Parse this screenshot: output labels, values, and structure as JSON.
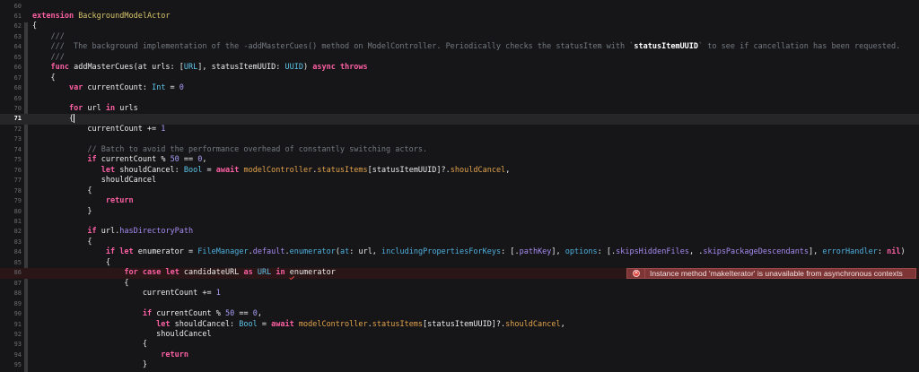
{
  "editor": {
    "current_line": 71,
    "error_line": 86,
    "error_message": "Instance method 'makeIterator' is unavailable from asynchronous contexts",
    "error_icon": "error-x-circle-icon",
    "lines": [
      {
        "n": "60",
        "tokens": []
      },
      {
        "n": "61",
        "tokens": [
          [
            "kw",
            "extension"
          ],
          [
            "pl",
            " "
          ],
          [
            "cls",
            "BackgroundModelActor"
          ]
        ]
      },
      {
        "n": "62",
        "tokens": [
          [
            "pl",
            "{"
          ]
        ]
      },
      {
        "n": "63",
        "tokens": [
          [
            "cm",
            "    ///"
          ]
        ]
      },
      {
        "n": "64",
        "tokens": [
          [
            "cm",
            "    ///  The background implementation of the -addMasterCues() method on ModelController. Periodically checks the statusItem with `"
          ],
          [
            "doc",
            "statusItemUUID"
          ],
          [
            "cm",
            "` to see if cancellation has been requested."
          ]
        ]
      },
      {
        "n": "65",
        "tokens": [
          [
            "cm",
            "    ///"
          ]
        ]
      },
      {
        "n": "66",
        "tokens": [
          [
            "pl",
            "    "
          ],
          [
            "kw",
            "func"
          ],
          [
            "pl",
            " addMasterCues(at urls: ["
          ],
          [
            "ty",
            "URL"
          ],
          [
            "pl",
            "], statusItemUUID: "
          ],
          [
            "ty",
            "UUID"
          ],
          [
            "pl",
            ") "
          ],
          [
            "kw",
            "async"
          ],
          [
            "pl",
            " "
          ],
          [
            "kw",
            "throws"
          ]
        ]
      },
      {
        "n": "67",
        "tokens": [
          [
            "pl",
            "    {"
          ]
        ]
      },
      {
        "n": "68",
        "tokens": [
          [
            "pl",
            "        "
          ],
          [
            "kw",
            "var"
          ],
          [
            "pl",
            " currentCount: "
          ],
          [
            "ty",
            "Int"
          ],
          [
            "pl",
            " = "
          ],
          [
            "num",
            "0"
          ]
        ]
      },
      {
        "n": "69",
        "tokens": []
      },
      {
        "n": "70",
        "tokens": [
          [
            "pl",
            "        "
          ],
          [
            "kw",
            "for"
          ],
          [
            "pl",
            " url "
          ],
          [
            "kw",
            "in"
          ],
          [
            "pl",
            " urls"
          ]
        ]
      },
      {
        "n": "71",
        "tokens": [
          [
            "pl",
            "        {"
          ]
        ]
      },
      {
        "n": "72",
        "tokens": [
          [
            "pl",
            "            currentCount += "
          ],
          [
            "num",
            "1"
          ]
        ]
      },
      {
        "n": "73",
        "tokens": []
      },
      {
        "n": "74",
        "tokens": [
          [
            "cm",
            "            // Batch to avoid the performance overhead of constantly switching actors."
          ]
        ]
      },
      {
        "n": "75",
        "tokens": [
          [
            "pl",
            "            "
          ],
          [
            "kw",
            "if"
          ],
          [
            "pl",
            " currentCount % "
          ],
          [
            "num",
            "50"
          ],
          [
            "pl",
            " == "
          ],
          [
            "num",
            "0"
          ],
          [
            "pl",
            ","
          ]
        ]
      },
      {
        "n": "76",
        "tokens": [
          [
            "pl",
            "               "
          ],
          [
            "kw",
            "let"
          ],
          [
            "pl",
            " shouldCancel: "
          ],
          [
            "ty",
            "Bool"
          ],
          [
            "pl",
            " = "
          ],
          [
            "kw",
            "await"
          ],
          [
            "pl",
            " "
          ],
          [
            "proj",
            "modelController"
          ],
          [
            "pl",
            "."
          ],
          [
            "proj",
            "statusItems"
          ],
          [
            "pl",
            "[statusItemUUID]?."
          ],
          [
            "proj",
            "shouldCancel"
          ],
          [
            "pl",
            ","
          ]
        ]
      },
      {
        "n": "77",
        "tokens": [
          [
            "pl",
            "               shouldCancel"
          ]
        ]
      },
      {
        "n": "78",
        "tokens": [
          [
            "pl",
            "            {"
          ]
        ]
      },
      {
        "n": "79",
        "tokens": [
          [
            "pl",
            "                "
          ],
          [
            "kw",
            "return"
          ]
        ]
      },
      {
        "n": "80",
        "tokens": [
          [
            "pl",
            "            }"
          ]
        ]
      },
      {
        "n": "81",
        "tokens": []
      },
      {
        "n": "82",
        "tokens": [
          [
            "pl",
            "            "
          ],
          [
            "kw",
            "if"
          ],
          [
            "pl",
            " url."
          ],
          [
            "sys",
            "hasDirectoryPath"
          ]
        ]
      },
      {
        "n": "83",
        "tokens": [
          [
            "pl",
            "            {"
          ]
        ]
      },
      {
        "n": "84",
        "tokens": [
          [
            "pl",
            "                "
          ],
          [
            "kw",
            "if"
          ],
          [
            "pl",
            " "
          ],
          [
            "kw",
            "let"
          ],
          [
            "pl",
            " enumerator = "
          ],
          [
            "sysb",
            "FileManager"
          ],
          [
            "pl",
            "."
          ],
          [
            "sys",
            "default"
          ],
          [
            "pl",
            "."
          ],
          [
            "sysb",
            "enumerator"
          ],
          [
            "pl",
            "("
          ],
          [
            "sysb",
            "at"
          ],
          [
            "pl",
            ": url, "
          ],
          [
            "sysb",
            "includingPropertiesForKeys"
          ],
          [
            "pl",
            ": [."
          ],
          [
            "sys",
            "pathKey"
          ],
          [
            "pl",
            "], "
          ],
          [
            "sysb",
            "options"
          ],
          [
            "pl",
            ": [."
          ],
          [
            "sys",
            "skipsHiddenFiles"
          ],
          [
            "pl",
            ", ."
          ],
          [
            "sys",
            "skipsPackageDescendants"
          ],
          [
            "pl",
            "], "
          ],
          [
            "sysb",
            "errorHandler"
          ],
          [
            "pl",
            ": "
          ],
          [
            "kw",
            "nil"
          ],
          [
            "pl",
            ")"
          ]
        ]
      },
      {
        "n": "85",
        "tokens": [
          [
            "pl",
            "                {"
          ]
        ]
      },
      {
        "n": "86",
        "tokens": [
          [
            "pl",
            "                    "
          ],
          [
            "kw",
            "for"
          ],
          [
            "pl",
            " "
          ],
          [
            "kw",
            "case"
          ],
          [
            "pl",
            " "
          ],
          [
            "kw",
            "let"
          ],
          [
            "pl",
            " candidateURL "
          ],
          [
            "kw",
            "as"
          ],
          [
            "pl",
            " "
          ],
          [
            "ty",
            "URL"
          ],
          [
            "pl",
            " "
          ],
          [
            "kw",
            "in"
          ],
          [
            "pl",
            " "
          ],
          [
            "err",
            "e"
          ],
          [
            "pl",
            "numerator"
          ]
        ]
      },
      {
        "n": "87",
        "tokens": [
          [
            "pl",
            "                    {"
          ]
        ]
      },
      {
        "n": "88",
        "tokens": [
          [
            "pl",
            "                        currentCount += "
          ],
          [
            "num",
            "1"
          ]
        ]
      },
      {
        "n": "89",
        "tokens": []
      },
      {
        "n": "90",
        "tokens": [
          [
            "pl",
            "                        "
          ],
          [
            "kw",
            "if"
          ],
          [
            "pl",
            " currentCount % "
          ],
          [
            "num",
            "50"
          ],
          [
            "pl",
            " == "
          ],
          [
            "num",
            "0"
          ],
          [
            "pl",
            ","
          ]
        ]
      },
      {
        "n": "91",
        "tokens": [
          [
            "pl",
            "                           "
          ],
          [
            "kw",
            "let"
          ],
          [
            "pl",
            " shouldCancel: "
          ],
          [
            "ty",
            "Bool"
          ],
          [
            "pl",
            " = "
          ],
          [
            "kw",
            "await"
          ],
          [
            "pl",
            " "
          ],
          [
            "proj",
            "modelController"
          ],
          [
            "pl",
            "."
          ],
          [
            "proj",
            "statusItems"
          ],
          [
            "pl",
            "[statusItemUUID]?."
          ],
          [
            "proj",
            "shouldCancel"
          ],
          [
            "pl",
            ","
          ]
        ]
      },
      {
        "n": "92",
        "tokens": [
          [
            "pl",
            "                           shouldCancel"
          ]
        ]
      },
      {
        "n": "93",
        "tokens": [
          [
            "pl",
            "                        {"
          ]
        ]
      },
      {
        "n": "94",
        "tokens": [
          [
            "pl",
            "                            "
          ],
          [
            "kw",
            "return"
          ]
        ]
      },
      {
        "n": "95",
        "tokens": [
          [
            "pl",
            "                        }"
          ]
        ]
      }
    ]
  }
}
